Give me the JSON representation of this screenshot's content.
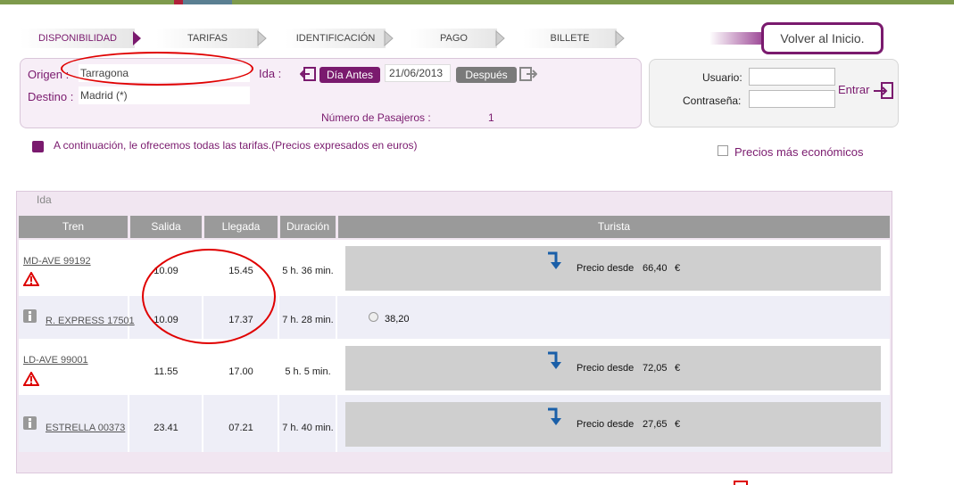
{
  "steps": [
    {
      "label": "DISPONIBILIDAD"
    },
    {
      "label": "TARIFAS"
    },
    {
      "label": "IDENTIFICACIÓN"
    },
    {
      "label": "PAGO"
    },
    {
      "label": "BILLETE"
    }
  ],
  "volver_label": "Volver al Inicio.",
  "search": {
    "origen_label": "Origen :",
    "origen_value": "Tarragona",
    "destino_label": "Destino :",
    "destino_value": "Madrid (*)",
    "ida_label": "Ida :",
    "dia_antes_label": "Día Antes",
    "date_value": "21/06/2013",
    "despues_label": "Después",
    "pasajeros_label": "Número de Pasajeros :",
    "pasajeros_value": "1"
  },
  "login": {
    "usuario_label": "Usuario:",
    "password_label": "Contraseña:",
    "entrar_label": "Entrar"
  },
  "info_text": "A continuación, le ofrecemos todas las tarifas.(Precios expresados en euros)",
  "cheapest_label": "Precios más económicos",
  "results": {
    "section_label": "Ida",
    "headers": [
      "Tren",
      "Salida",
      "Llegada",
      "Duración",
      "Turista"
    ],
    "rows": [
      {
        "tren": "MD-AVE 99192",
        "salida": "10.09",
        "llegada": "15.45",
        "duracion": "5 h. 36 min.",
        "precio_label": "Precio desde",
        "precio": "66,40",
        "currency": "€",
        "icon": "warning-icon"
      },
      {
        "tren": "R. EXPRESS 17501",
        "salida": "10.09",
        "llegada": "17.37",
        "duracion": "7 h. 28 min.",
        "radio_price": "38,20",
        "icon": "info-icon"
      },
      {
        "tren": "LD-AVE 99001",
        "salida": "11.55",
        "llegada": "17.00",
        "duracion": "5 h. 5 min.",
        "precio_label": "Precio desde",
        "precio": "72,05",
        "currency": "€",
        "icon": "warning-icon"
      },
      {
        "tren": "ESTRELLA 00373",
        "salida": "23.41",
        "llegada": "07.21",
        "duracion": "7 h. 40 min.",
        "precio_label": "Precio desde",
        "precio": "27,65",
        "currency": "€",
        "icon": "info-icon"
      }
    ]
  },
  "colors": {
    "accent": "#7a1a6e",
    "header_grey": "#9a9a9a",
    "annotation": "#e00000"
  }
}
